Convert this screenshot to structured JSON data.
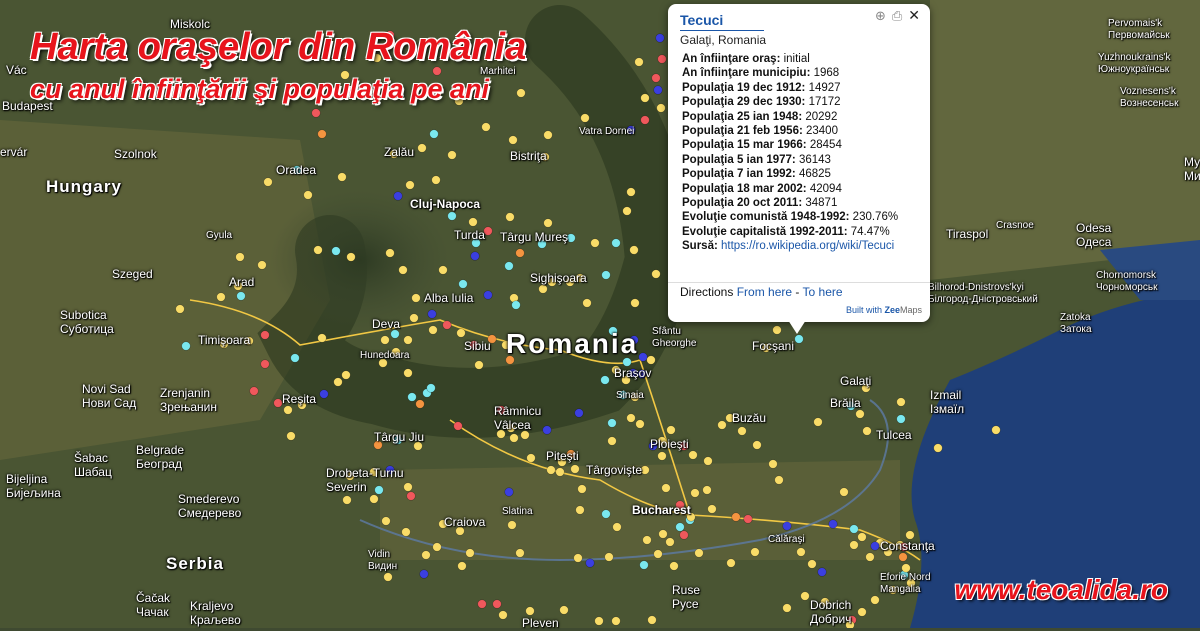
{
  "map": {
    "title_line1": "Harta oraşelor din România",
    "title_line2": "cu anul înfiinţării şi populaţia pe ani",
    "website": "www.teoalida.ro",
    "colors": {
      "red": "#f0585c",
      "orange": "#f49440",
      "yellow": "#f9dc68",
      "cyan": "#7ae8ef",
      "blue": "#3b3fe0",
      "land": "#46522f",
      "sea": "#1f3f78",
      "river": "#f2c844"
    },
    "labels": {
      "miskolc": "Miskolc",
      "vac": "Vác",
      "budapest": "Budapest",
      "ervar": "ervár",
      "szolnok": "Szolnok",
      "hungary": "Hungary",
      "gyula": "Gyula",
      "szeged": "Szeged",
      "subotica": "Subotica",
      "subotica_cyr": "Суботица",
      "novi_sad": "Novi Sad",
      "novi_sad_cyr": "Нови Сад",
      "zrenjanin": "Zrenjanin",
      "zrenjanin_cyr": "Зрењанин",
      "belgrade": "Belgrade",
      "belgrade_cyr": "Београд",
      "sabac": "Šabac",
      "sabac_cyr": "Шабац",
      "bijeljina": "Bijeljina",
      "bijeljina_cyr": "Бијељина",
      "smederevo": "Smederevo",
      "smederevo_cyr": "Смедерево",
      "serbia": "Serbia",
      "cacak": "Čačak",
      "cacak_cyr": "Чачак",
      "kraljevo": "Kraljevo",
      "kraljevo_cyr": "Краљево",
      "oradea": "Oradea",
      "arad": "Arad",
      "timisoara": "Timişoara",
      "resita": "Reşita",
      "deva": "Deva",
      "hunedoara": "Hunedoara",
      "cluj": "Cluj-Napoca",
      "turda": "Turda",
      "zalau": "Zalău",
      "alba": "Alba Iulia",
      "sibiu": "Sibiu",
      "sighisoara": "Sighişoara",
      "targu_mures": "Târgu Mureş",
      "bistrita": "Bistriţa",
      "vatra_dornei": "Vatra Dornei",
      "marhitei": "Marhitei",
      "romania": "Romania",
      "sfantu": "Sfântu",
      "gheorghe": "Gheorghe",
      "brasov": "Braşov",
      "sinaia": "Sinaia",
      "focsani": "Focşani",
      "galati": "Galaţi",
      "braila": "Brăila",
      "izmail": "Izmail",
      "izmail_cyr": "Ізмаїл",
      "tulcea": "Tulcea",
      "buzau": "Buzău",
      "ploiesti": "Ploieşti",
      "targoviste": "Târgovişte",
      "pitesti": "Piteşti",
      "rm_valcea1": "Râmnicu",
      "rm_valcea2": "Vâlcea",
      "targu_jiu": "Târgu Jiu",
      "drobeta": "Drobeta-Turnu",
      "severin": "Severin",
      "craiova": "Craiova",
      "slatina": "Slatina",
      "bucharest": "Bucharest",
      "calarasi": "Călăraşi",
      "constanta": "Constanţa",
      "eforie1": "Eforie Nord",
      "mangalia": "Mangalia",
      "ruse": "Ruse",
      "ruse_cyr": "Русе",
      "dobrich": "Dobrich",
      "dobrich_cyr": "Добрич",
      "pleven": "Pleven",
      "vidin": "Vidin",
      "vidin_cyr": "Видин",
      "tiraspol": "Tiraspol",
      "odesa": "Odesa",
      "odesa_cyr": "Одеса",
      "crasnoe": "Crasnoe",
      "pervomaisk": "Pervomais'k",
      "pervomaisk_cyr": "Первомайськ",
      "yuzhnoukrainsk": "Yuzhnoukrains'k",
      "yuzhnoukrainsk_cyr": "Южноукраїнськ",
      "voznesensk": "Voznesens'k",
      "voznesensk_cyr": "Вознесенськ",
      "my": "Му",
      "my2": "Ми",
      "chornomorsk": "Chornomorsk",
      "chornomorsk_cyr": "Чорноморськ",
      "bilhorod": "Bilhorod-Dnistrovs'kyi",
      "bilhorod_cyr": "Білгород-Дністровський",
      "zatoka": "Zatoka",
      "zatoka_cyr": "Затока"
    }
  },
  "popup": {
    "title": "Tecuci",
    "subtitle": "Galaţi, Romania",
    "rows": [
      {
        "label": "An înfiinţare oraş:",
        "value": "initial"
      },
      {
        "label": "An înfiinţare municipiu:",
        "value": "1968"
      },
      {
        "label": "Populaţia 19 dec 1912:",
        "value": "14927"
      },
      {
        "label": "Populaţia 29 dec 1930:",
        "value": "17172"
      },
      {
        "label": "Populaţia 25 ian 1948:",
        "value": "20292"
      },
      {
        "label": "Populaţia 21 feb 1956:",
        "value": "23400"
      },
      {
        "label": "Populaţia 15 mar 1966:",
        "value": "28454"
      },
      {
        "label": "Populaţia 5 ian 1977:",
        "value": "36143"
      },
      {
        "label": "Populaţia 7 ian 1992:",
        "value": "46825"
      },
      {
        "label": "Populaţia 18 mar 2002:",
        "value": "42094"
      },
      {
        "label": "Populaţia 20 oct 2011:",
        "value": "34871"
      },
      {
        "label": "Evoluţie comunistă 1948-1992:",
        "value": "230.76%"
      },
      {
        "label": "Evoluţie capitalistă 1992-2011:",
        "value": "74.47%"
      }
    ],
    "source_label": "Sursă:",
    "source_link": "https://ro.wikipedia.org/wiki/Tecuci",
    "directions_label": "Directions",
    "from_here": "From here",
    "separator": "-",
    "to_here": "To here",
    "built_with": "Built with",
    "brand_zee": "Zee",
    "brand_maps": "Maps",
    "icons": [
      "zoom-icon",
      "print-icon",
      "close-icon"
    ]
  }
}
